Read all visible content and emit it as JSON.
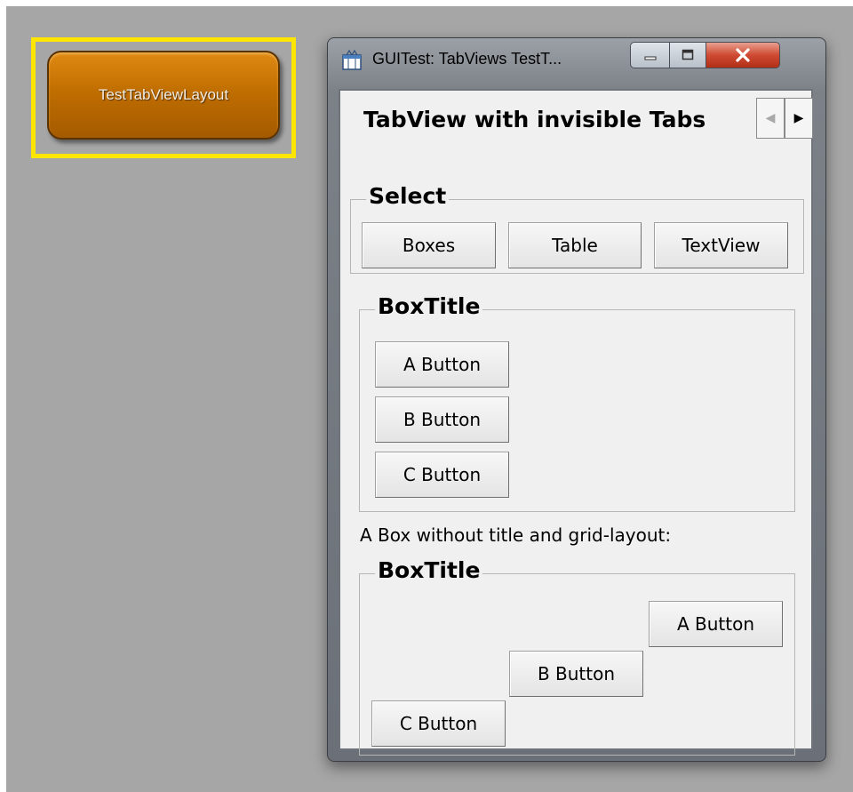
{
  "launcher": {
    "label": "TestTabViewLayout"
  },
  "window": {
    "title": "GUITest: TabViews TestT...",
    "caption": {
      "minimize": "minimize-icon",
      "maximize": "maximize-icon",
      "close": "close-icon"
    }
  },
  "tabview": {
    "title": "TabView with invisible Tabs"
  },
  "select_group": {
    "title": "Select",
    "buttons": [
      "Boxes",
      "Table",
      "TextView"
    ]
  },
  "box1": {
    "title": "BoxTitle",
    "buttons": [
      "A Button",
      "B Button",
      "C Button"
    ]
  },
  "plain_label": "A Box without title and grid-layout:",
  "box2": {
    "title": "BoxTitle",
    "buttons": [
      "A Button",
      "B Button",
      "C Button"
    ]
  },
  "colors": {
    "launcher_highlight": "#ffe600",
    "launcher_fill": "#c06e00",
    "close_button": "#cf4a32",
    "desktop": "#a6a6a6"
  }
}
